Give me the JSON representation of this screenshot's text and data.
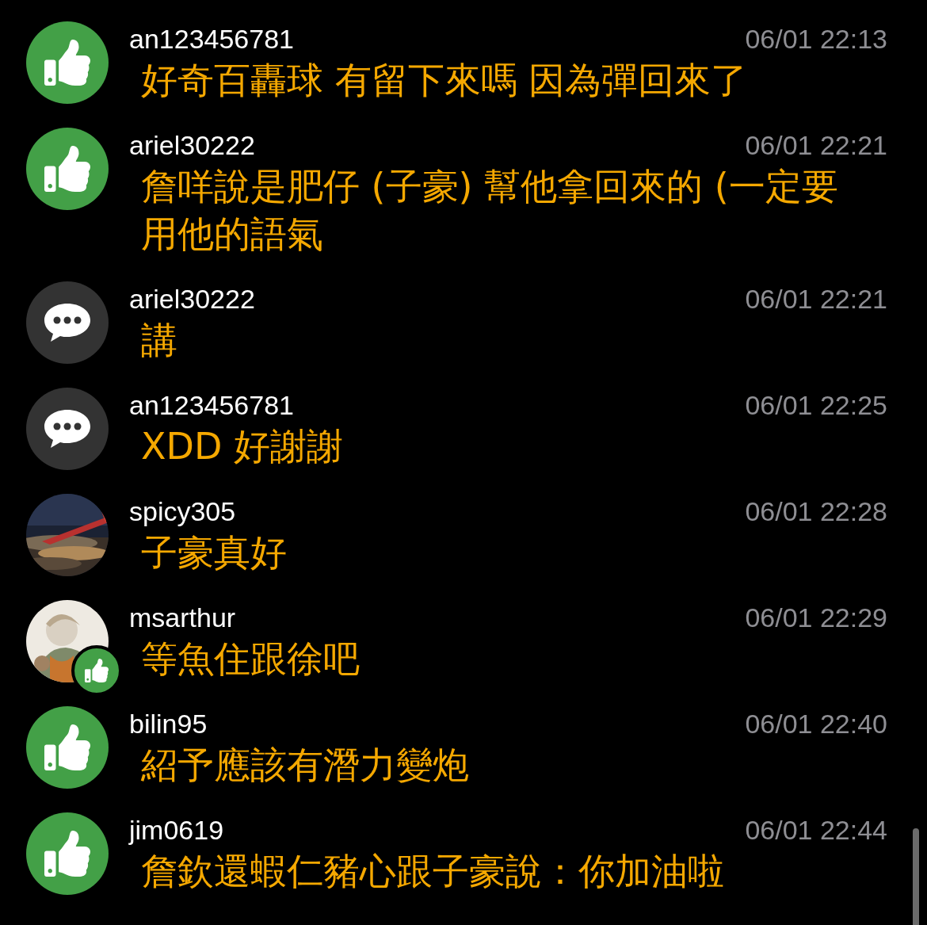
{
  "comments": [
    {
      "kind": "like",
      "liked_badge": false,
      "user": "an123456781",
      "time": "06/01 22:13",
      "message": "好奇百轟球 有留下來嗎 因為彈回來了"
    },
    {
      "kind": "like",
      "liked_badge": false,
      "user": "ariel30222",
      "time": "06/01 22:21",
      "message": "詹咩說是肥仔 (子豪) 幫他拿回來的 (一定要用他的語氣"
    },
    {
      "kind": "comment",
      "liked_badge": false,
      "user": "ariel30222",
      "time": "06/01 22:21",
      "message": "講"
    },
    {
      "kind": "comment",
      "liked_badge": false,
      "user": "an123456781",
      "time": "06/01 22:25",
      "message": "XDD 好謝謝"
    },
    {
      "kind": "picture",
      "liked_badge": false,
      "user": "spicy305",
      "time": "06/01 22:28",
      "message": "子豪真好"
    },
    {
      "kind": "picture",
      "liked_badge": true,
      "user": "msarthur",
      "time": "06/01 22:29",
      "message": "等魚住跟徐吧"
    },
    {
      "kind": "like",
      "liked_badge": false,
      "user": "bilin95",
      "time": "06/01 22:40",
      "message": "紹予應該有潛力變炮"
    },
    {
      "kind": "like",
      "liked_badge": false,
      "user": "jim0619",
      "time": "06/01 22:44",
      "message": "詹欽還蝦仁豬心跟子豪說：你加油啦"
    }
  ]
}
